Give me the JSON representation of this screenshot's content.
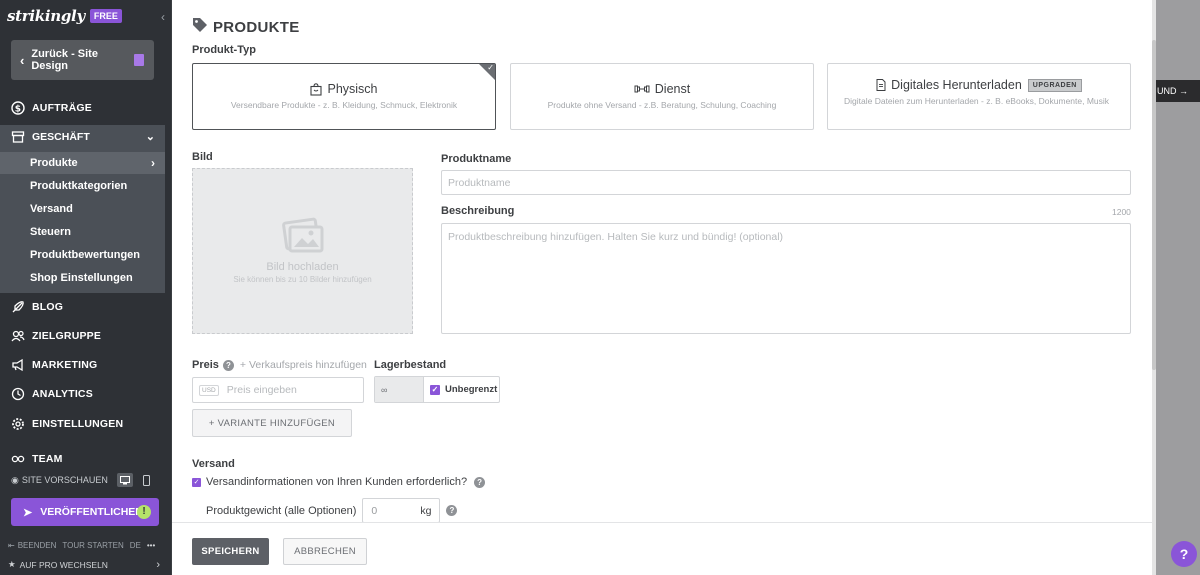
{
  "brand": {
    "logo": "strikingly",
    "badge": "FREE"
  },
  "sidebar": {
    "back_label": "Zurück - Site Design",
    "items": {
      "orders": "AUFTRÄGE",
      "business": "GESCHÄFT",
      "blog": "BLOG",
      "audience": "ZIELGRUPPE",
      "marketing": "MARKETING",
      "analytics": "ANALYTICS",
      "settings": "EINSTELLUNGEN",
      "team": "TEAM"
    },
    "sub_items": [
      "Produkte",
      "Produktkategorien",
      "Versand",
      "Steuern",
      "Produktbewertungen",
      "Shop Einstellungen"
    ],
    "preview_label": "SITE VORSCHAUEN",
    "publish_label": "VERÖFFENTLICHEN",
    "publish_alert": "!",
    "footer": {
      "quit": "BEENDEN",
      "tour": "TOUR STARTEN",
      "lang": "DE",
      "more": "•••",
      "upgrade": "AUF PRO WECHSELN"
    }
  },
  "background": {
    "button_text": "UND →"
  },
  "modal": {
    "title": "PRODUKTE",
    "product_type_label": "Produkt-Typ",
    "types": [
      {
        "title": "Physisch",
        "desc": "Versendbare Produkte - z. B. Kleidung, Schmuck, Elektronik"
      },
      {
        "title": "Dienst",
        "desc": "Produkte ohne Versand - z.B. Beratung, Schulung, Coaching"
      },
      {
        "title": "Digitales Herunterladen",
        "desc": "Digitale Dateien zum Herunterladen - z. B. eBooks, Dokumente, Musik",
        "tag": "UPGRADEN"
      }
    ],
    "image_label": "Bild",
    "upload_title": "Bild hochladen",
    "upload_sub": "Sie können bis zu 10 Bilder hinzufügen",
    "name_label": "Produktname",
    "name_placeholder": "Produktname",
    "desc_label": "Beschreibung",
    "desc_count": "1200",
    "desc_placeholder": "Produktbeschreibung hinzufügen. Halten Sie kurz und bündig! (optional)",
    "price_label": "Preis",
    "sale_price_link": "+ Verkaufspreis hinzufügen",
    "currency": "USD",
    "price_placeholder": "Preis eingeben",
    "stock_label": "Lagerbestand",
    "stock_value": "∞",
    "unlimited_label": "Unbegrenzt",
    "variant_button": "+ VARIANTE HINZUFÜGEN",
    "shipping_label": "Versand",
    "shipping_info_label": "Versandinformationen von Ihren Kunden erforderlich?",
    "weight_label": "Produktgewicht (alle Optionen)",
    "weight_value": "0",
    "weight_unit": "kg",
    "save": "SPEICHERN",
    "cancel": "ABBRECHEN"
  },
  "help_bubble": "?",
  "colors": {
    "accent": "#8a55d8",
    "sidebar": "#2e3136",
    "sidebar_section": "#4b5057"
  }
}
